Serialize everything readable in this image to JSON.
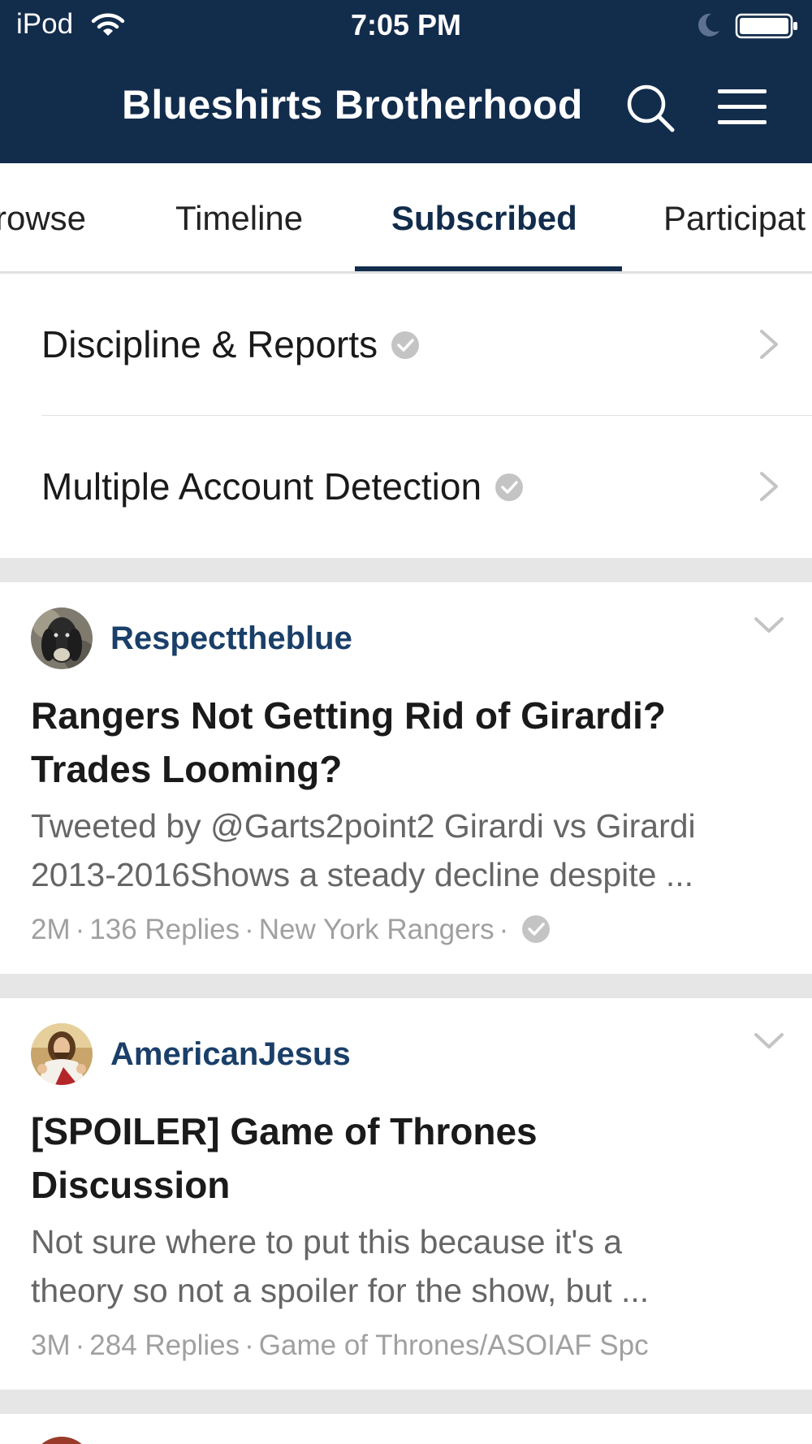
{
  "status_bar": {
    "carrier": "iPod",
    "time": "7:05 PM"
  },
  "header": {
    "title": "Blueshirts Brotherhood",
    "icons": [
      "search-icon",
      "menu-icon"
    ]
  },
  "tabs": [
    {
      "label": "Browse",
      "visible_text": "rowse"
    },
    {
      "label": "Timeline"
    },
    {
      "label": "Subscribed",
      "selected": true
    },
    {
      "label": "Participating",
      "visible_text": "Participat"
    }
  ],
  "subscribed_categories": [
    {
      "label": "Discipline & Reports"
    },
    {
      "label": "Multiple Account Detection"
    }
  ],
  "topics": [
    {
      "author": "Respecttheblue",
      "title_line1": "Rangers Not Getting Rid of Girardi?",
      "title_line2": "Trades Looming?",
      "excerpt_line1": "Tweeted by @Garts2point2 Girardi vs Girardi",
      "excerpt_line2": "2013-2016Shows a steady decline despite ...",
      "age": "2M",
      "replies": "136 Replies",
      "category": "New York Rangers"
    },
    {
      "author": "AmericanJesus",
      "title_line1": "[SPOILER] Game of Thrones",
      "title_line2": "Discussion",
      "excerpt_line1": "Not sure where to put this because it's a",
      "excerpt_line2": "theory so not a spoiler for the show, but ...",
      "age": "3M",
      "replies": "284 Replies",
      "category": "Game of Thrones/ASOIAF Spc"
    }
  ],
  "colors": {
    "header_bg": "#122c4c",
    "accent": "#1a3f69",
    "separator": "#e6e6e6",
    "meta_text": "#a0a0a0"
  }
}
